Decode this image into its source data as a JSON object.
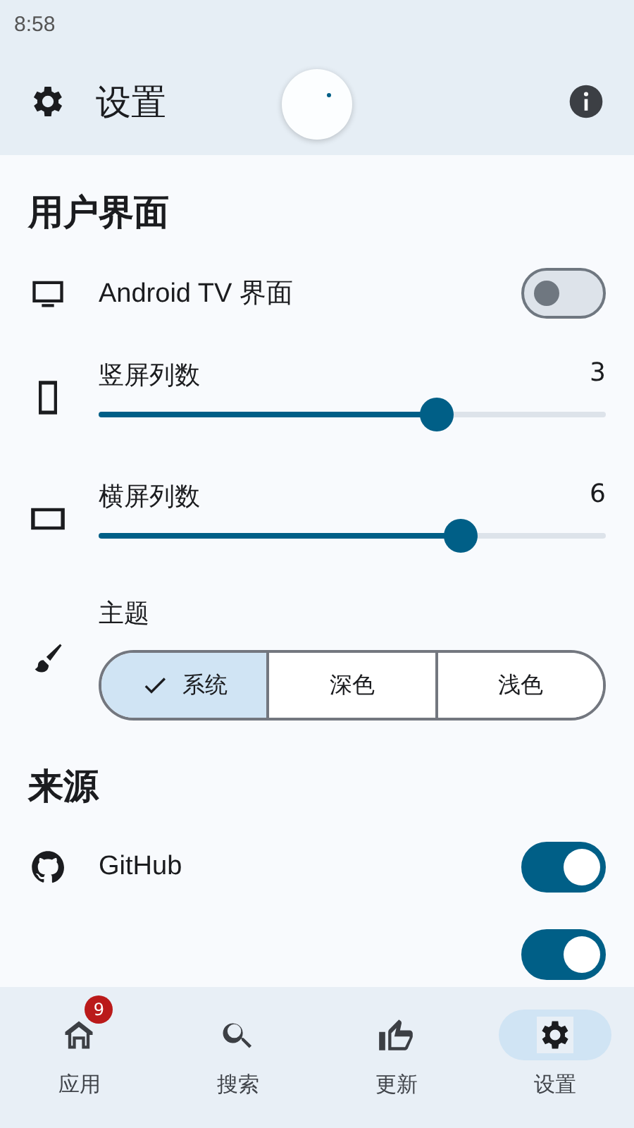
{
  "status_bar": {
    "time": "8:58"
  },
  "app_bar": {
    "title": "设置",
    "refreshing": true
  },
  "sections": [
    {
      "title": "用户界面",
      "items": [
        {
          "kind": "switch",
          "label": "Android TV 界面",
          "on": false
        },
        {
          "kind": "slider",
          "label": "竖屏列数",
          "reading": "3",
          "level": 0.667
        },
        {
          "kind": "slider",
          "label": "横屏列数",
          "reading": "6",
          "level": 0.714
        },
        {
          "kind": "segmented",
          "label": "主题",
          "options": [
            {
              "label": "系统",
              "selected": true
            },
            {
              "label": "深色",
              "selected": false
            },
            {
              "label": "浅色",
              "selected": false
            }
          ]
        }
      ]
    },
    {
      "title": "来源",
      "items": [
        {
          "kind": "switch",
          "label": "GitHub",
          "on": true
        },
        {
          "kind": "switch",
          "on": true
        }
      ]
    }
  ],
  "bottom_nav": [
    {
      "label": "应用",
      "badge": "9",
      "selected": false
    },
    {
      "label": "搜索",
      "selected": false
    },
    {
      "label": "更新",
      "selected": false
    },
    {
      "label": "设置",
      "selected": true
    }
  ]
}
